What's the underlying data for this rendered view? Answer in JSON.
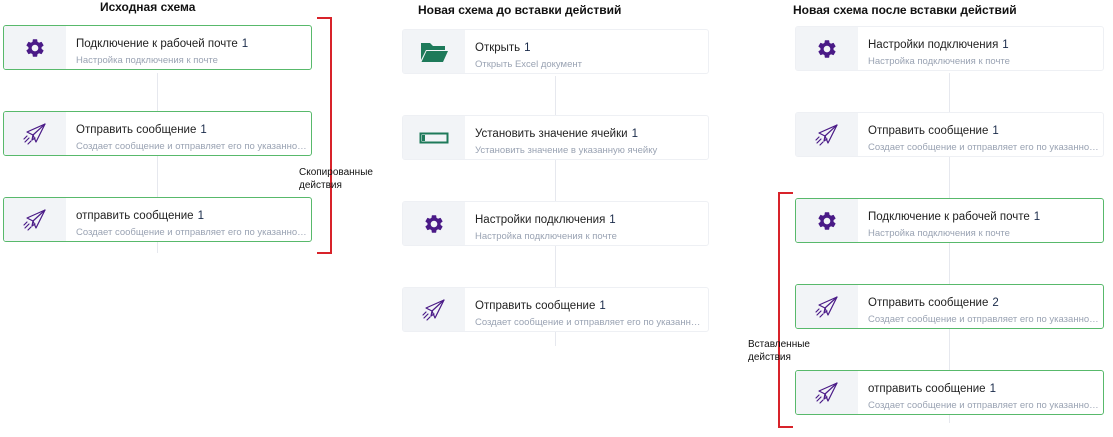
{
  "colors": {
    "icon_purple": "#4a1a87",
    "icon_green": "#1e7a5a",
    "selected_border": "#58b96b",
    "bracket_red": "#d8232a"
  },
  "columns": [
    {
      "title": "Исходная схема",
      "cards": [
        {
          "icon": "gear-icon",
          "name": "Подключение к рабочей почте",
          "num": "1",
          "desc": "Настройка подключения к почте",
          "selected": true
        },
        {
          "icon": "paper-plane-icon",
          "name": "Отправить сообщение",
          "num": "1",
          "desc": "Создает сообщение и отправляет его по указанному адресу",
          "selected": true
        },
        {
          "icon": "paper-plane-icon",
          "name": "отправить сообщение",
          "num": "1",
          "desc": "Создает сообщение и отправляет его по указанному адресу",
          "selected": true
        }
      ]
    },
    {
      "title": "Новая схема  до вставки действий",
      "cards": [
        {
          "icon": "folder-icon",
          "name": "Открыть",
          "num": "1",
          "desc": "Открыть Excel документ",
          "selected": false
        },
        {
          "icon": "cell-icon",
          "name": "Установить значение ячейки",
          "num": "1",
          "desc": "Установить значение в указанную ячейку",
          "selected": false
        },
        {
          "icon": "gear-icon",
          "name": "Настройки подключения",
          "num": "1",
          "desc": "Настройка подключения к почте",
          "selected": false
        },
        {
          "icon": "paper-plane-icon",
          "name": "Отправить сообщение",
          "num": "1",
          "desc": "Создает сообщение и отправляет его по указанному адресу",
          "selected": false
        }
      ]
    },
    {
      "title": "Новая схема после вставки действий",
      "cards": [
        {
          "icon": "gear-icon",
          "name": "Настройки подключения",
          "num": "1",
          "desc": "Настройка подключения к почте",
          "selected": false
        },
        {
          "icon": "paper-plane-icon",
          "name": "Отправить сообщение",
          "num": "1",
          "desc": "Создает сообщение и отправляет его по указанному адресу",
          "selected": false
        },
        {
          "icon": "gear-icon",
          "name": "Подключение к рабочей почте",
          "num": "1",
          "desc": "Настройка подключения к почте",
          "selected": true
        },
        {
          "icon": "paper-plane-icon",
          "name": "Отправить сообщение",
          "num": "2",
          "desc": "Создает сообщение и отправляет его по указанному адресу",
          "selected": true
        },
        {
          "icon": "paper-plane-icon",
          "name": "отправить сообщение",
          "num": "1",
          "desc": "Создает сообщение и отправляет его по указанному адресу",
          "selected": true
        }
      ]
    }
  ],
  "annotations": {
    "copied": "Скопированные действия",
    "pasted": "Вставленные действия"
  }
}
